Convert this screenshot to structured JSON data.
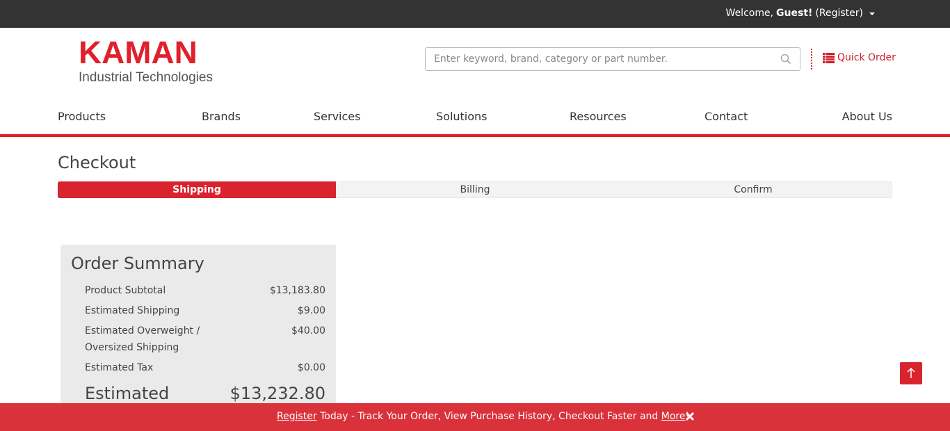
{
  "topbar": {
    "welcome_prefix": "Welcome,",
    "welcome_user": "Guest!",
    "register_label": "(Register)"
  },
  "logo": {
    "main": "KAMAN",
    "sub": "Industrial Technologies"
  },
  "search": {
    "placeholder": "Enter keyword, brand, category or part number.",
    "icon": "search-icon"
  },
  "quick_order": {
    "label": "Quick Order",
    "icon": "list-icon"
  },
  "nav": {
    "items": [
      "Products",
      "Brands",
      "Services",
      "Solutions",
      "Resources",
      "Contact",
      "About Us"
    ]
  },
  "checkout": {
    "title": "Checkout",
    "steps": [
      "Shipping",
      "Billing",
      "Confirm"
    ],
    "active_step": "Shipping"
  },
  "order_summary": {
    "title": "Order Summary",
    "rows": [
      {
        "label": "Product Subtotal",
        "value": "$13,183.80"
      },
      {
        "label": "Estimated Shipping",
        "value": "$9.00"
      },
      {
        "label": "Estimated Overweight / Oversized Shipping",
        "value": "$40.00"
      },
      {
        "label": "Estimated Tax",
        "value": "$0.00"
      }
    ],
    "total_label": "Estimated",
    "total_value": "$13,232.80"
  },
  "banner": {
    "register_link": "Register",
    "text_middle": " Today - Track Your Order, View Purchase History, Checkout Faster and ",
    "more_link": "More",
    "text_end": "!",
    "close_icon": "close-icon"
  },
  "scroll_top": {
    "icon": "arrow-up-icon"
  },
  "colors": {
    "brand_red": "#d9232e",
    "topbar": "#333333",
    "banner": "#d9323a",
    "summary_bg": "#eaeaea"
  }
}
